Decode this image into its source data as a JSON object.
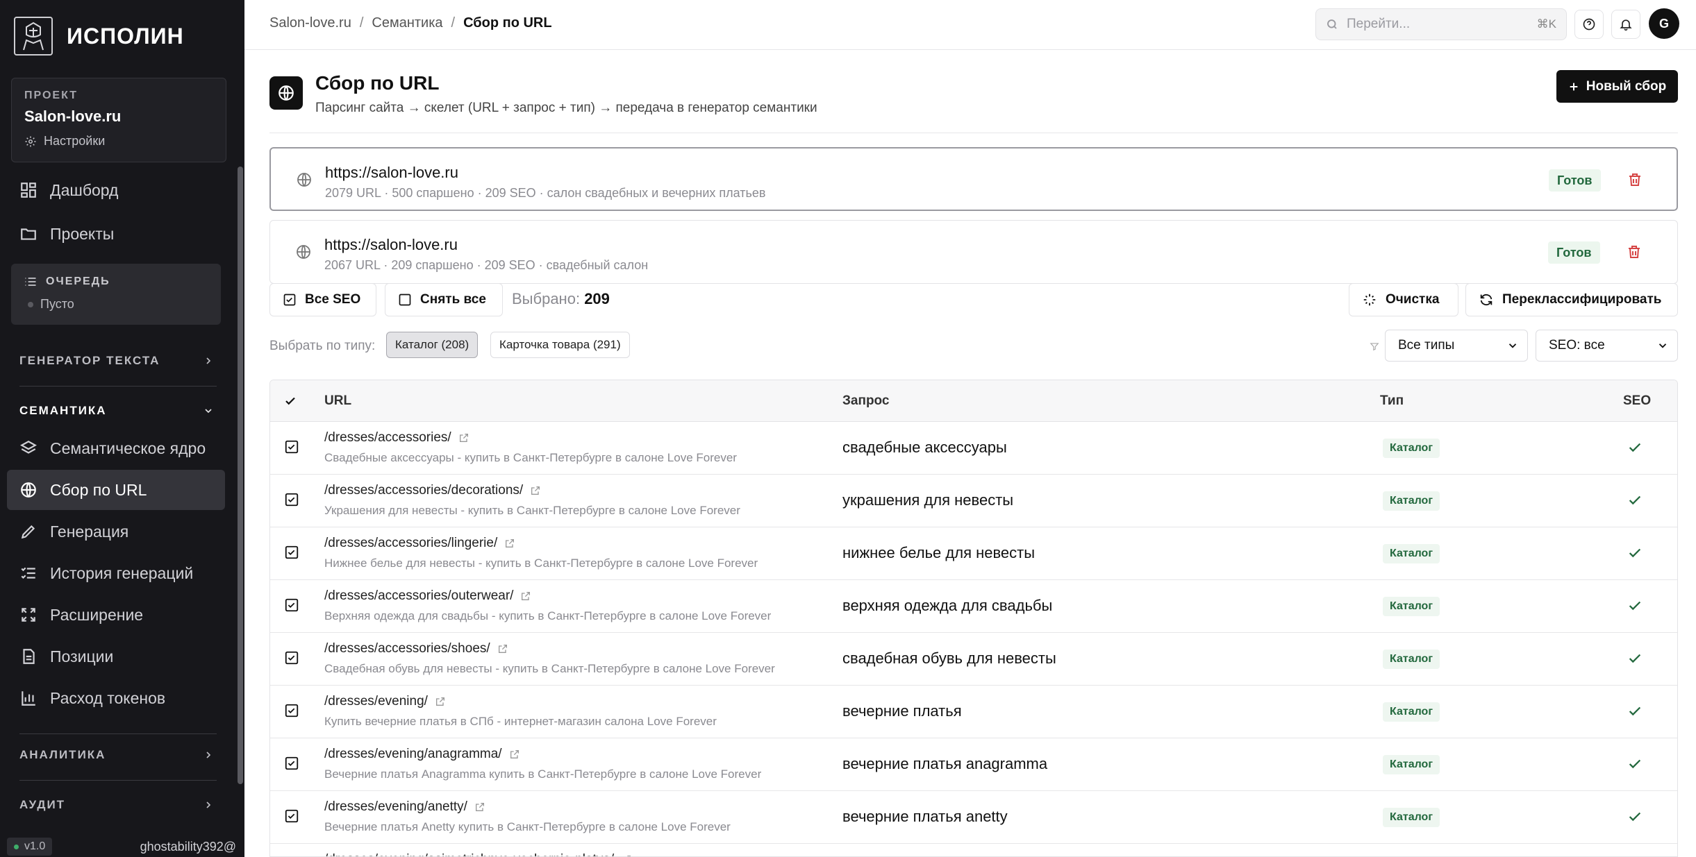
{
  "app": {
    "logo_text": "ИСПОЛИН",
    "version": "v1.0",
    "username": "ghostability392@"
  },
  "project": {
    "label": "ПРОЕКТ",
    "name": "Salon-love.ru",
    "settings": "Настройки"
  },
  "nav": {
    "dashboard": "Дашборд",
    "projects": "Проекты",
    "queue_title": "ОЧЕРЕДЬ",
    "queue_status": "Пусто",
    "section_text_gen": "ГЕНЕРАТОР ТЕКСТА",
    "section_semantics": "СЕМАНТИКА",
    "semantic_core": "Семантическое ядро",
    "collect_url": "Сбор по URL",
    "generation": "Генерация",
    "history": "История генераций",
    "expansion": "Расширение",
    "positions": "Позиции",
    "tokens": "Расход токенов",
    "section_analytics": "АНАЛИТИКА",
    "section_audit": "АУДИТ"
  },
  "header": {
    "breadcrumb": [
      "Salon-love.ru",
      "Семантика",
      "Сбор по URL"
    ],
    "breadcrumb_sep": "/",
    "search_placeholder": "Перейти...",
    "search_shortcut": "⌘K",
    "avatar": "G"
  },
  "page": {
    "title": "Сбор по URL",
    "subtitle": "Парсинг сайта → скелет (URL + запрос + тип) → передача в генератор семантики",
    "new_button": "Новый сбор"
  },
  "collections": [
    {
      "url": "https://salon-love.ru",
      "meta": "2079 URL · 500 спаршено · 209 SEO · салон свадебных и вечерних платьев",
      "status": "Готов"
    },
    {
      "url": "https://salon-love.ru",
      "meta": "2067 URL · 209 спаршено · 209 SEO · свадебный салон",
      "status": "Готов"
    }
  ],
  "toolbar": {
    "all_seo": "Все SEO",
    "unselect_all": "Снять все",
    "selected_label": "Выбрано:",
    "selected_count": "209",
    "cleanup": "Очистка",
    "reclassify": "Переклассифицировать",
    "type_label": "Выбрать по типу:",
    "chip_catalog": "Каталог (208)",
    "chip_product": "Карточка товара (291)",
    "type_select": "Все типы",
    "seo_select": "SEO: все"
  },
  "table": {
    "headers": {
      "url": "URL",
      "query": "Запрос",
      "type": "Тип",
      "seo": "SEO"
    },
    "rows": [
      {
        "path": "/dresses/accessories/",
        "title": "Свадебные аксессуары - купить в Санкт-Петербурге в салоне Love Forever",
        "query": "свадебные аксессуары",
        "type": "Каталог"
      },
      {
        "path": "/dresses/accessories/decorations/",
        "title": "Украшения для невесты - купить в Санкт-Петербурге в салоне Love Forever",
        "query": "украшения для невесты",
        "type": "Каталог"
      },
      {
        "path": "/dresses/accessories/lingerie/",
        "title": "Нижнее белье для невесты - купить в Санкт-Петербурге в салоне Love Forever",
        "query": "нижнее белье для невесты",
        "type": "Каталог"
      },
      {
        "path": "/dresses/accessories/outerwear/",
        "title": "Верхняя одежда для свадьбы - купить в Санкт-Петербурге в салоне Love Forever",
        "query": "верхняя одежда для свадьбы",
        "type": "Каталог"
      },
      {
        "path": "/dresses/accessories/shoes/",
        "title": "Свадебная обувь для невесты - купить в Санкт-Петербурге в салоне Love Forever",
        "query": "свадебная обувь для невесты",
        "type": "Каталог"
      },
      {
        "path": "/dresses/evening/",
        "title": "Купить вечерние платья в СПб - интернет-магазин салона Love Forever",
        "query": "вечерние платья",
        "type": "Каталог"
      },
      {
        "path": "/dresses/evening/anagramma/",
        "title": "Вечерние платья Anagramma купить в Санкт-Петербурге в салоне Love Forever",
        "query": "вечерние платья anagramma",
        "type": "Каталог"
      },
      {
        "path": "/dresses/evening/anetty/",
        "title": "Вечерние платья Anetty купить в Санкт-Петербурге в салоне Love Forever",
        "query": "вечерние платья anetty",
        "type": "Каталог"
      },
      {
        "path": "/dresses/evening/asimetrichnye-vechernie-platya/",
        "title": "",
        "query": "",
        "type": ""
      }
    ]
  }
}
